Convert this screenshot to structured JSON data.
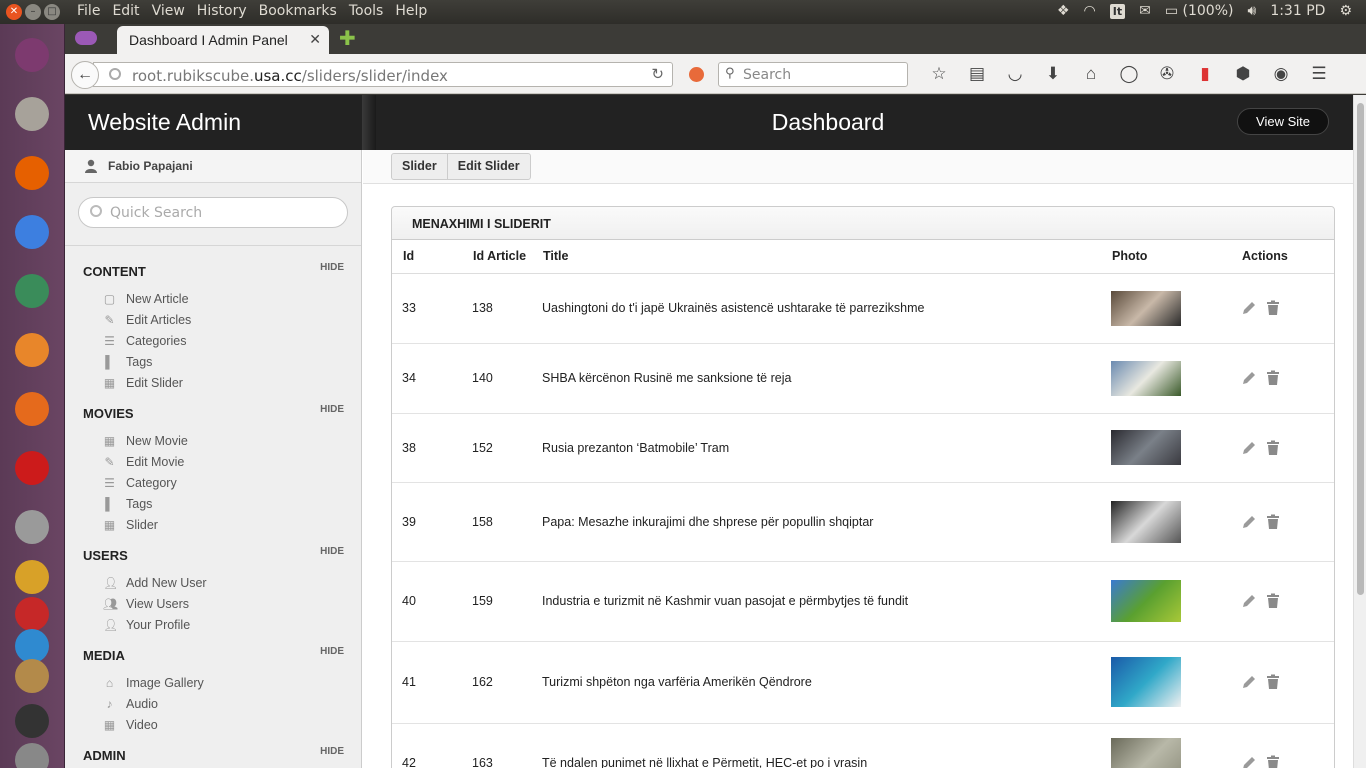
{
  "os": {
    "menus": [
      "File",
      "Edit",
      "View",
      "History",
      "Bookmarks",
      "Tools",
      "Help"
    ],
    "keyboard_layout": "It",
    "battery": "(100%)",
    "clock": "1:31 PD",
    "launcher_apps": [
      {
        "name": "ubuntu-dash-icon",
        "color": "#7d3a6f"
      },
      {
        "name": "files-icon",
        "color": "#a7a29a"
      },
      {
        "name": "firefox-icon",
        "color": "#e66000"
      },
      {
        "name": "chrome-icon",
        "color": "#3d7fe0"
      },
      {
        "name": "atom-icon",
        "color": "#3a8c5a"
      },
      {
        "name": "system-settings-icon",
        "color": "#e8862a"
      },
      {
        "name": "software-center-icon",
        "color": "#e56a1c"
      },
      {
        "name": "opera-icon",
        "color": "#cc1b1b"
      },
      {
        "name": "settings-tools-icon",
        "color": "#9a9a9a"
      },
      {
        "name": "genie-icon",
        "color": "#d8a128"
      },
      {
        "name": "filezilla-icon",
        "color": "#c62828"
      },
      {
        "name": "skype-icon",
        "color": "#2f8ad0"
      },
      {
        "name": "notes-icon",
        "color": "#b38a4a"
      },
      {
        "name": "terminal-icon",
        "color": "#333333"
      },
      {
        "name": "scanner-icon",
        "color": "#888888"
      }
    ]
  },
  "browser": {
    "tab_title": "Dashboard I Admin Panel",
    "url_prefix": "root.rubikscube.",
    "url_host": "usa.cc",
    "url_path": "/sliders/slider/index",
    "search_placeholder": "Search"
  },
  "site": {
    "brand": "Website Admin",
    "page_title": "Dashboard",
    "view_site_label": "View Site",
    "user_name": "Fabio Papajani",
    "quick_search_placeholder": "Quick Search",
    "hide_label": "HIDE",
    "sections": [
      {
        "title": "CONTENT",
        "items": [
          {
            "label": "New Article",
            "icon": "file-icon"
          },
          {
            "label": "Edit Articles",
            "icon": "pencil-icon"
          },
          {
            "label": "Categories",
            "icon": "list-icon"
          },
          {
            "label": "Tags",
            "icon": "bookmark-icon"
          },
          {
            "label": "Edit Slider",
            "icon": "film-icon"
          }
        ]
      },
      {
        "title": "MOVIES",
        "items": [
          {
            "label": "New Movie",
            "icon": "film-icon"
          },
          {
            "label": "Edit Movie",
            "icon": "pencil-icon"
          },
          {
            "label": "Category",
            "icon": "list-icon"
          },
          {
            "label": "Tags",
            "icon": "bookmark-icon"
          },
          {
            "label": "Slider",
            "icon": "film-icon"
          }
        ]
      },
      {
        "title": "USERS",
        "items": [
          {
            "label": "Add New User",
            "icon": "user-add-icon"
          },
          {
            "label": "View Users",
            "icon": "users-icon"
          },
          {
            "label": "Your Profile",
            "icon": "user-icon"
          }
        ]
      },
      {
        "title": "MEDIA",
        "items": [
          {
            "label": "Image Gallery",
            "icon": "picture-icon"
          },
          {
            "label": "Audio",
            "icon": "audio-icon"
          },
          {
            "label": "Video",
            "icon": "film-icon"
          }
        ]
      },
      {
        "title": "ADMIN",
        "items": []
      }
    ],
    "breadcrumb": [
      "Slider",
      "Edit Slider"
    ],
    "panel_title": "MENAXHIMI I SLIDERIT",
    "table": {
      "headers": [
        "Id",
        "Id Article",
        "Title",
        "Photo",
        "Actions"
      ],
      "rows": [
        {
          "id": "33",
          "article": "138",
          "title": "Uashingtoni do t'i japë Ukrainës asistencë ushtarake të parrezikshme",
          "photo_colors": [
            "#5a4a3a",
            "#c8b8a8",
            "#2a2a2a"
          ]
        },
        {
          "id": "34",
          "article": "140",
          "title": "SHBA kërcënon Rusinë me sanksione të reja",
          "photo_colors": [
            "#6a8ab0",
            "#e8e8e0",
            "#3a5a2a"
          ]
        },
        {
          "id": "38",
          "article": "152",
          "title": "Rusia prezanton ‘Batmobile’ Tram",
          "photo_colors": [
            "#2a2a30",
            "#7a8088",
            "#3a3a40"
          ]
        },
        {
          "id": "39",
          "article": "158",
          "title": "Papa: Mesazhe inkurajimi dhe shprese për popullin shqiptar",
          "photo_colors": [
            "#222222",
            "#d8d8d8",
            "#555555"
          ]
        },
        {
          "id": "40",
          "article": "159",
          "title": "Industria e turizmit në Kashmir vuan pasojat e përmbytjes të fundit",
          "photo_colors": [
            "#3a7ad0",
            "#5aa030",
            "#a8c838"
          ]
        },
        {
          "id": "41",
          "article": "162",
          "title": "Turizmi shpëton nga varfëria Amerikën Qëndrore",
          "photo_colors": [
            "#1a5aa8",
            "#30a8c8",
            "#f0f0f0"
          ]
        },
        {
          "id": "42",
          "article": "163",
          "title": "Të ndalen punimet në llixhat e Përmetit, HEC-et po i vrasin",
          "photo_colors": [
            "#6a6a5a",
            "#b8b8a8",
            "#8a8a78"
          ]
        }
      ]
    }
  }
}
